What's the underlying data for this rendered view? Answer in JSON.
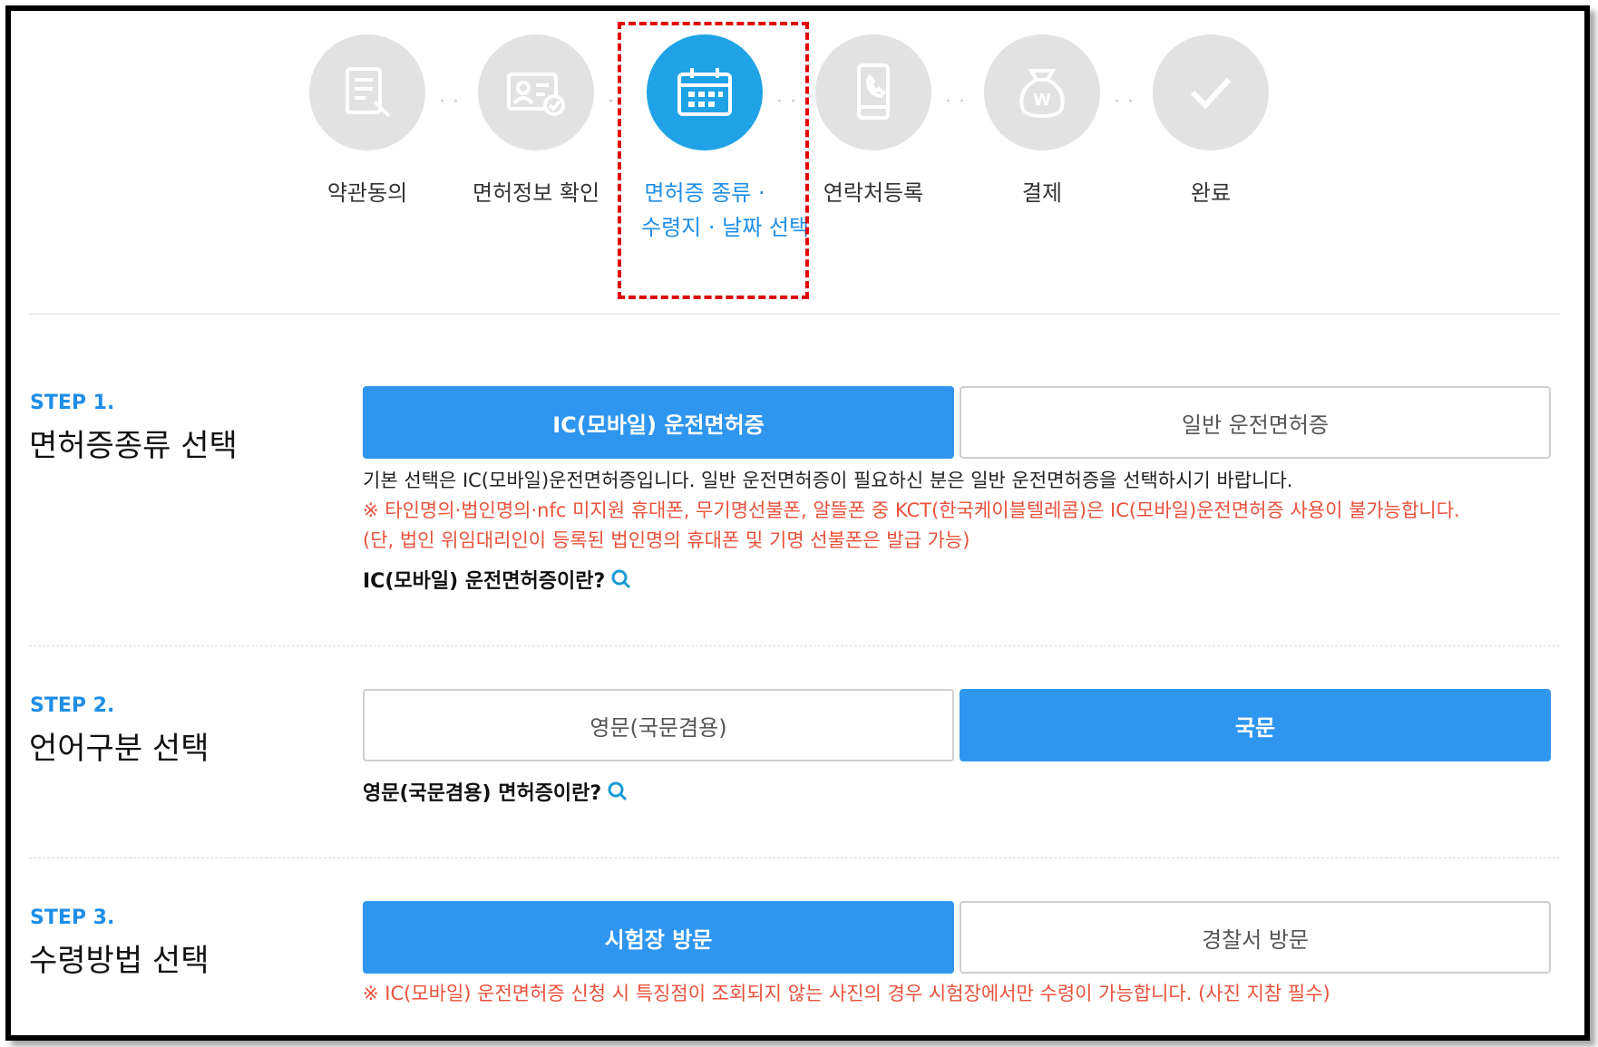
{
  "stepper": {
    "steps": [
      {
        "label": "약관동의",
        "icon": "document-pen-icon"
      },
      {
        "label": "면허정보 확인",
        "icon": "id-card-check-icon"
      },
      {
        "label": "면허증 종류 ·",
        "label2": "수령지 · 날짜 선택",
        "icon": "calendar-icon",
        "active": true
      },
      {
        "label": "연락처등록",
        "icon": "mobile-phone-icon"
      },
      {
        "label": "결제",
        "icon": "money-bag-won-icon"
      },
      {
        "label": "완료",
        "icon": "checkmark-icon"
      }
    ]
  },
  "step1": {
    "no": "STEP 1.",
    "title": "면허증종류 선택",
    "option_selected": "IC(모바일) 운전면허증",
    "option_other": "일반 운전면허증",
    "info": "기본 선택은 IC(모바일)운전면허증입니다. 일반 운전면허증이 필요하신 분은 일반 운전면허증을 선택하시기 바랍니다.",
    "warning1": "※ 타인명의·법인명의·nfc 미지원 휴대폰, 무기명선불폰, 알뜰폰 중 KCT(한국케이블텔레콤)은 IC(모바일)운전면허증 사용이 불가능합니다.",
    "warning2": "(단, 법인 위임대리인이 등록된 법인명의 휴대폰 및 기명 선불폰은 발급 가능)",
    "help": "IC(모바일) 운전면허증이란?"
  },
  "step2": {
    "no": "STEP 2.",
    "title": "언어구분 선택",
    "option_other": "영문(국문겸용)",
    "option_selected": "국문",
    "help": "영문(국문겸용) 면허증이란?"
  },
  "step3": {
    "no": "STEP 3.",
    "title": "수령방법 선택",
    "option_selected": "시험장 방문",
    "option_other": "경찰서 방문",
    "warning": "※ IC(모바일) 운전면허증 신청 시 특징점이 조회되지 않는 사진의 경우 시험장에서만 수령이 가능합니다. (사진 지참 필수)"
  },
  "colors": {
    "accent": "#2f96f0",
    "active_step": "#1fa3e6",
    "inactive_step": "#e2e2e2",
    "warning": "#e8523c",
    "highlight_border": "#e00000"
  }
}
